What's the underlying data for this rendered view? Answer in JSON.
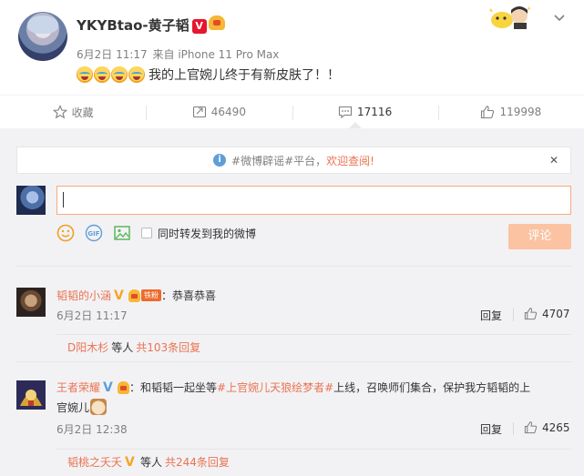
{
  "post": {
    "username": "YKYBtao-黄子韬",
    "date": "6月2日 11:17",
    "from_label": "来自",
    "device": "iPhone 11 Pro Max",
    "text": "我的上官婉儿终于有新皮肤了！！",
    "emoji_count": 4
  },
  "actions": {
    "favorite": "收藏",
    "repost": "46490",
    "comment": "17116",
    "like": "119998"
  },
  "notice": {
    "text": "#微博辟谣#平台，",
    "link": "欢迎查阅!"
  },
  "composer": {
    "input_value": "",
    "repost_label": "同时转发到我的微博",
    "submit_label": "评论"
  },
  "comments": [
    {
      "name": "韬韬的小涵",
      "fan_badge": "铁粉",
      "text": "：恭喜恭喜",
      "time": "6月2日 11:17",
      "reply_label": "回复",
      "likes": "4707",
      "sub_name": "D阳木杉",
      "sub_mid": "等人",
      "sub_count": "共103条回复"
    },
    {
      "name": "王者荣耀",
      "text_a": "：和韬韬一起坐等",
      "hashtag": "#上官婉儿天狼绘梦者#",
      "text_b": "上线，召唤师们集合，保护我方韬韬的上",
      "text_c": "官婉儿",
      "time": "6月2日 12:38",
      "reply_label": "回复",
      "likes": "4265",
      "sub_name": "韬桃之夭夭",
      "sub_mid": "等人",
      "sub_count": "共244条回复"
    }
  ]
}
